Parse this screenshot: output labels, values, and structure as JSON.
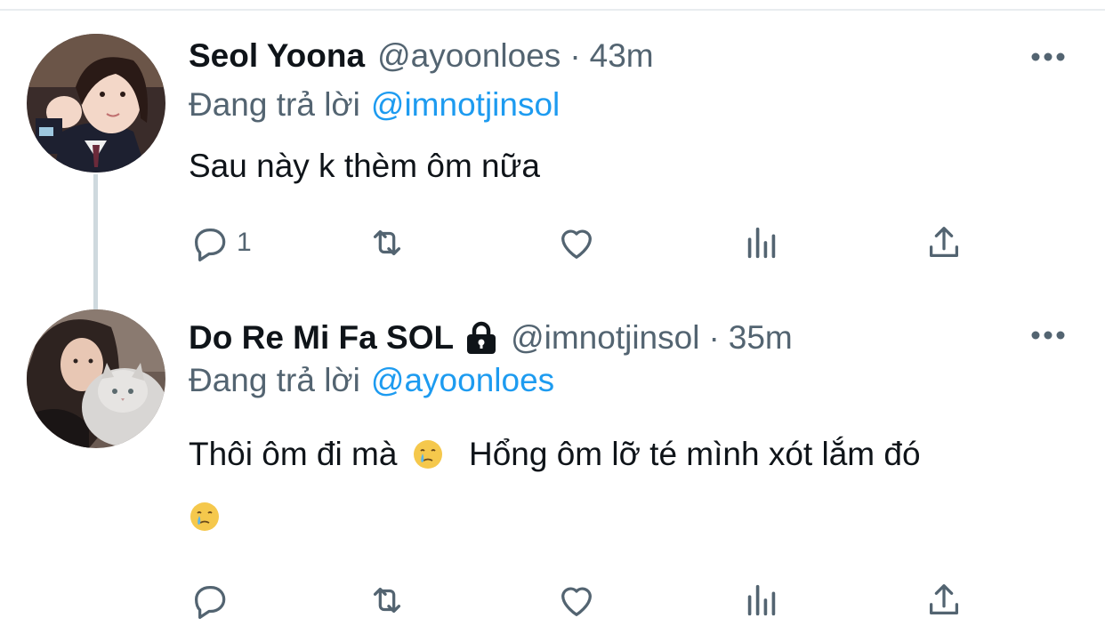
{
  "tweets": [
    {
      "display_name": "Seol Yoona",
      "handle": "@ayoonloes",
      "separator": "·",
      "time": "43m",
      "reply_prefix": "Đang trả lời",
      "reply_to": "@imnotjinsol",
      "text_lines": [
        "Sau này k thèm ôm nữa"
      ],
      "protected": false,
      "actions": {
        "reply_count": "1",
        "retweet_count": "",
        "like_count": ""
      },
      "icons": {
        "avatar": "avatar-photo",
        "more": "more-dots-icon",
        "reply": "reply-bubble-icon",
        "retweet": "retweet-icon",
        "like": "heart-icon",
        "analytics": "analytics-bars-icon",
        "share": "share-upload-icon"
      }
    },
    {
      "display_name": "Do Re Mi Fa SOL",
      "handle": "@imnotjinsol",
      "separator": "·",
      "time": "35m",
      "reply_prefix": "Đang trả lời",
      "reply_to": "@ayoonloes",
      "text_part1": "Thôi ôm đi mà",
      "text_part2": "Hổng ôm lỡ té mình xót lắm đó",
      "emoji": "crying-face-emoji",
      "protected": true,
      "actions": {
        "reply_count": "",
        "retweet_count": "",
        "like_count": ""
      },
      "icons": {
        "avatar": "avatar-photo",
        "lock": "lock-icon",
        "more": "more-dots-icon",
        "reply": "reply-bubble-icon",
        "retweet": "retweet-icon",
        "like": "heart-icon",
        "analytics": "analytics-bars-icon",
        "share": "share-upload-icon"
      }
    }
  ],
  "colors": {
    "primary_text": "#0f1419",
    "secondary_text": "#536471",
    "link": "#1d9bf0",
    "thread_line": "#cfd9de",
    "icon": "#536471"
  }
}
